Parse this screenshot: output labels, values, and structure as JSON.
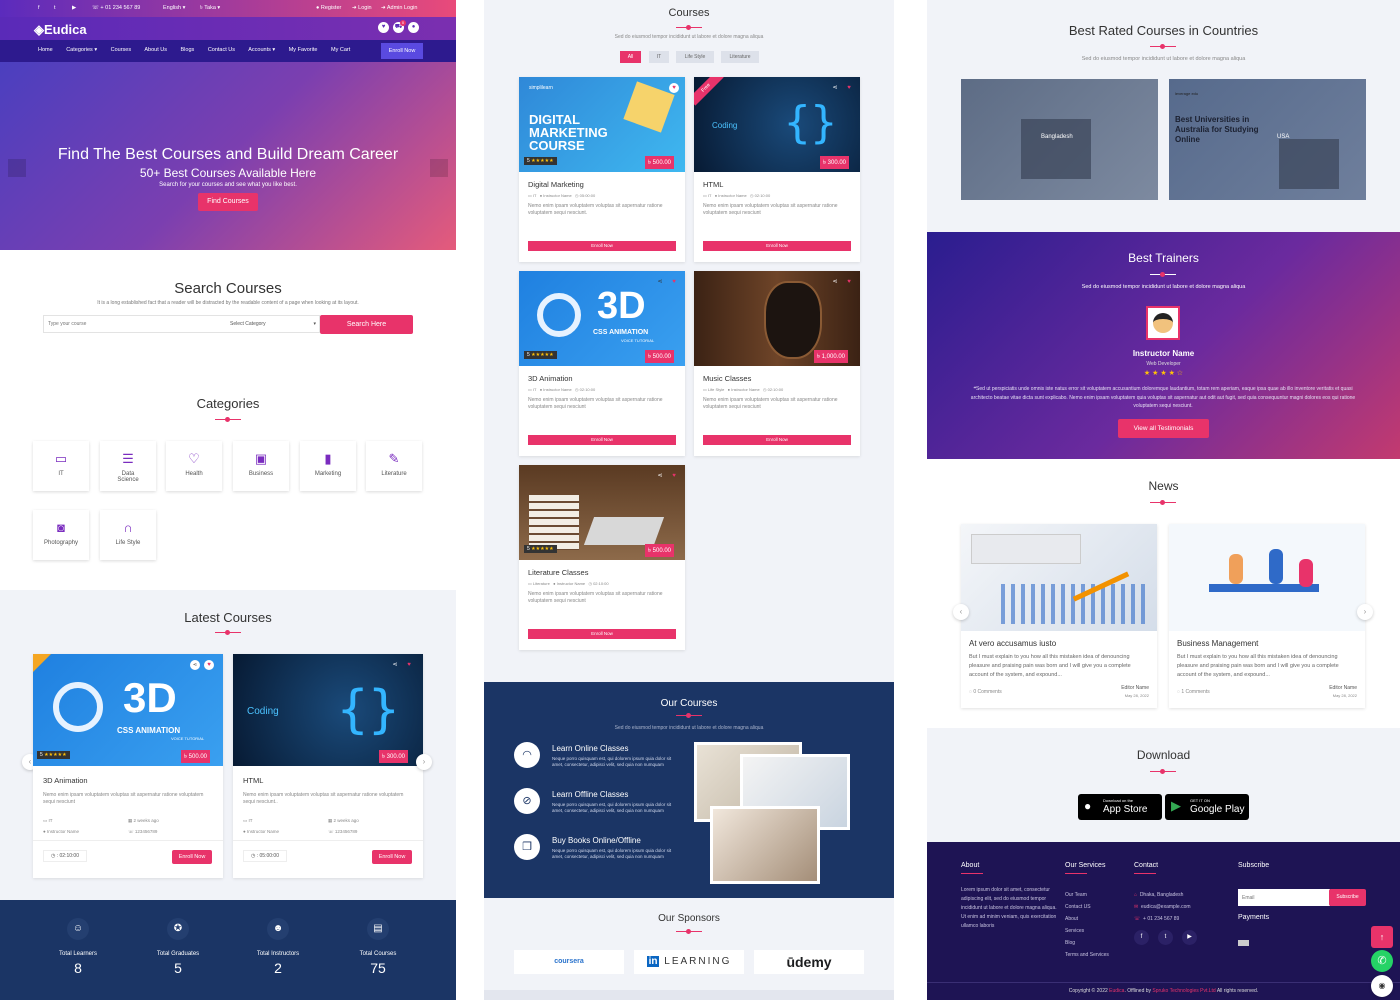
{
  "topbar": {
    "phone": "+ 01 234 567 89",
    "language": "English",
    "currency": "Taka",
    "register": "Register",
    "login": "Login",
    "admin_login": "Admin Login",
    "cart_count": "0"
  },
  "brand": {
    "name": "Eudica"
  },
  "nav": {
    "items": [
      "Home",
      "Categories",
      "Courses",
      "About Us",
      "Blogs",
      "Contact Us",
      "Accounts",
      "My Favorite",
      "My Cart"
    ],
    "enroll": "Enroll Now"
  },
  "hero": {
    "title": "Find The Best Courses and Build Dream Career",
    "subtitle": "50+ Best Courses Available Here",
    "text": "Search for your courses and see what you like best.",
    "button": "Find Courses"
  },
  "search": {
    "title": "Search Courses",
    "text": "It is a long established fact that a reader will be distracted by the readable content of a page when looking at its layout.",
    "placeholder": "Type your course",
    "category_label": "Select Category",
    "button": "Search Here"
  },
  "categories": {
    "title": "Categories",
    "items": [
      {
        "label": "IT",
        "icon": "monitor-icon"
      },
      {
        "label": "Data Science",
        "icon": "database-icon"
      },
      {
        "label": "Health",
        "icon": "heart-icon"
      },
      {
        "label": "Business",
        "icon": "briefcase-icon"
      },
      {
        "label": "Marketing",
        "icon": "bar-chart-icon"
      },
      {
        "label": "Literature",
        "icon": "edit-icon"
      },
      {
        "label": "Photography",
        "icon": "camera-icon"
      },
      {
        "label": "Life Style",
        "icon": "headphones-icon"
      }
    ]
  },
  "latest": {
    "title": "Latest Courses",
    "items": [
      {
        "name": "3D Animation",
        "desc": "Nemo enim ipsam voluptatem voluptas sit aspernatur ratione voluptatem sequi nesciunt",
        "category": "IT",
        "posted": "2 weeks ago",
        "instructor": "Instructor Name",
        "phone": "123456789",
        "duration": ": 02:10:00",
        "price": "৳ 500.00",
        "rating": "5",
        "enroll": "Enroll Now"
      },
      {
        "name": "HTML",
        "desc": "Nemo enim ipsam voluptatem voluptas sit aspernatur ratione voluptatem sequi nesciunt..",
        "category": "IT",
        "posted": "2 weeks ago",
        "instructor": "Instructor Name",
        "phone": "123456789",
        "duration": ": 05:00:00",
        "price": "৳ 300.00",
        "enroll": "Enroll Now"
      }
    ]
  },
  "stats": [
    {
      "label": "Total Learners",
      "value": "8"
    },
    {
      "label": "Total Graduates",
      "value": "5"
    },
    {
      "label": "Total Instructors",
      "value": "2"
    },
    {
      "label": "Total Courses",
      "value": "75"
    }
  ],
  "courses": {
    "title": "Courses",
    "subtitle": "Sed do eiusmod tempor incididunt ut labore et dolore magna aliqua",
    "filters": [
      "All",
      "IT",
      "Life Style",
      "Literature"
    ],
    "enroll": "Enroll Now",
    "items": [
      {
        "name": "Digital Marketing",
        "category": "IT",
        "instructor": "Instructor Name",
        "duration": "05:00:00",
        "price": "৳ 500.00",
        "rating": "5",
        "desc": "Nemo enim ipsam voluptatem voluptas sit aspernatur ratione voluptatem sequi nesciunt.",
        "img_text": "DIGITAL MARKETING COURSE",
        "img_brand": "simplilearn"
      },
      {
        "name": "HTML",
        "category": "IT",
        "instructor": "Instructor Name",
        "duration": "02:10:00",
        "price": "৳ 300.00",
        "desc": "Nemo enim ipsam voluptatem voluptas sit aspernatur ratione voluptatem sequi nesciunt",
        "img_text": "Coding",
        "ribbon": "Free"
      },
      {
        "name": "3D Animation",
        "category": "IT",
        "instructor": "Instructor Name",
        "duration": "02:10:00",
        "price": "৳ 500.00",
        "rating": "5",
        "desc": "Nemo enim ipsam voluptatem voluptas sit aspernatur ratione voluptatem sequi nesciunt",
        "img_text": "3D",
        "img_sub": "CSS ANIMATION",
        "img_sub2": "VOICE TUTORIAL"
      },
      {
        "name": "Music Classes",
        "category": "Life Style",
        "instructor": "Instructor Name",
        "duration": "02:10:00",
        "price": "৳ 1,000.00",
        "desc": "Nemo enim ipsam voluptatem voluptas sit aspernatur ratione voluptatem sequi nesciunt"
      },
      {
        "name": "Literature Classes",
        "category": "Literature",
        "instructor": "Instructor Name",
        "duration": "02:10:00",
        "price": "৳ 500.00",
        "rating": "5",
        "desc": "Nemo enim ipsam voluptatem voluptas sit aspernatur ratione voluptatem sequi nesciunt"
      }
    ]
  },
  "our_courses": {
    "title": "Our Courses",
    "subtitle": "Sed do eiusmod tempor incididunt ut labore et dolore magna aliqua",
    "features": [
      {
        "title": "Learn Online Classes",
        "icon": "wifi-icon",
        "desc": "Neque porro quisquam est, qui dolorem ipsum quia dolor sit amet, consectetur, adipisci velit, sed quia non numquam"
      },
      {
        "title": "Learn Offline Classes",
        "icon": "wifi-off-icon",
        "desc": "Neque porro quisquam est, qui dolorem ipsum quia dolor sit amet, consectetur, adipisci velit, sed quia non numquam"
      },
      {
        "title": "Buy Books Online/Offline",
        "icon": "book-icon",
        "desc": "Neque porro quisquam est, qui dolorem ipsum quia dolor sit amet, consectetur, adipisci velit, sed quia non numquam"
      }
    ]
  },
  "sponsors": {
    "title": "Our Sponsors",
    "items": [
      "coursera",
      "LEARNING",
      "ūdemy"
    ],
    "linkedin_mark": "in"
  },
  "countries": {
    "title": "Best Rated Courses in Countries",
    "subtitle": "Sed do eiusmod tempor incididunt ut labore et dolore magna aliqua",
    "items": [
      {
        "name": "Bangladesh"
      },
      {
        "name": "USA",
        "img_text": "Best Universities in Australia for Studying Online",
        "img_brand": "leverage edu"
      }
    ]
  },
  "trainers": {
    "title": "Best Trainers",
    "subtitle": "Sed do eiusmod tempor incididunt ut labore et dolore magna aliqua",
    "name": "Instructor Name",
    "role": "Web Developer",
    "quote": "Sed ut perspiciatis unde omnis iste natus error sit voluptatem accusantium doloremque laudantium, totam rem aperiam, eaque ipsa quae ab illo inventore veritatis et quasi architecto beatae vitae dicta sunt explicabo. Nemo enim ipsam voluptatem quia voluptas sit aspernatur aut odit aut fugit, sed quia consequuntur magni dolores eos qui ratione voluptatem sequi nesciunt.",
    "button": "View all Testimonials"
  },
  "news": {
    "title": "News",
    "items": [
      {
        "title": "At vero accusamus iusto",
        "text": "But I must explain to you how all this mistaken idea of denouncing pleasure and praising pain was born and I will give you a complete account of the system, and expound...",
        "comments": "0 Comments",
        "author": "Editor Name",
        "date": "May 28, 2022"
      },
      {
        "title": "Business Management",
        "text": "But I must explain to you how all this mistaken idea of denouncing pleasure and praising pain was born and I will give you a complete account of the system, and expound...",
        "comments": "1 Comments",
        "author": "Editor Name",
        "date": "May 28, 2022"
      }
    ]
  },
  "download": {
    "title": "Download",
    "appstore_small": "Download on the",
    "appstore": "App Store",
    "googleplay_small": "GET IT ON",
    "googleplay": "Google Play"
  },
  "footer": {
    "about_title": "About",
    "about_text": "Lorem ipsum dolor sit amet, consectetur adipiscing elit, sed do eiusmod tempor incididunt ut labore et dolore magna aliqua. Ut enim ad minim veniam, quis exercitation ullamco laboris",
    "services_title": "Our Services",
    "services": [
      "Our Team",
      "Contact US",
      "About",
      "Services",
      "Blog",
      "Terms and Services"
    ],
    "contact_title": "Contact",
    "address": "Dhaka, Bangladesh",
    "email": "eudica@example.com",
    "phone": "+ 01 234 567 89",
    "subscribe_title": "Subscribe",
    "email_placeholder": "Email",
    "subscribe_button": "Subscribe",
    "payments_title": "Payments",
    "copyright_pre": "Copyright © 2022",
    "copyright_brand": "Eudica",
    "copyright_mid": ". Offlined by",
    "copyright_company": "Spruko Technologies Pvt.Ltd",
    "copyright_post": "All rights reserved."
  },
  "colors": {
    "accent": "#e8336a",
    "navy": "#1b3565",
    "purple": "#5a2ab8"
  }
}
